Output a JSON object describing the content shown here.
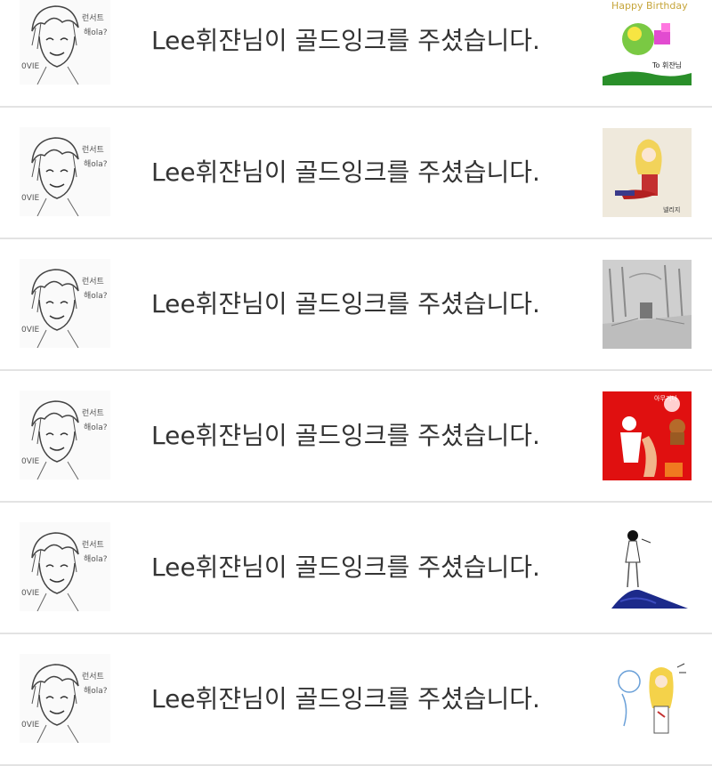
{
  "notifications": [
    {
      "message": "Lee휘쟌님이 골드잉크를 주셨습니다.",
      "thumbnail": "birthday-drawing-thumbnail",
      "caption": "Happy Birthday",
      "signature": "To 휘쟌님"
    },
    {
      "message": "Lee휘쟌님이 골드잉크를 주셨습니다.",
      "thumbnail": "blonde-girl-drawing-thumbnail"
    },
    {
      "message": "Lee휘쟌님이 골드잉크를 주셨습니다.",
      "thumbnail": "pencil-forest-drawing-thumbnail"
    },
    {
      "message": "Lee휘쟌님이 골드잉크를 주셨습니다.",
      "thumbnail": "red-background-drawing-thumbnail"
    },
    {
      "message": "Lee휘쟌님이 골드잉크를 주셨습니다.",
      "thumbnail": "small-figure-drawing-thumbnail"
    },
    {
      "message": "Lee휘쟌님이 골드잉크를 주셨습니다.",
      "thumbnail": "blonde-character-sketch-thumbnail"
    }
  ],
  "colors": {
    "text": "#333333",
    "divider": "#e3e3e3",
    "background": "#ffffff"
  }
}
